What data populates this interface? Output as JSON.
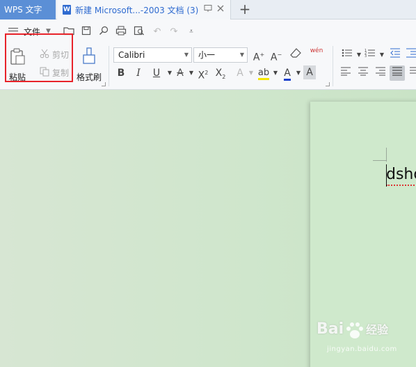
{
  "tabs": {
    "app_label": "WPS 文字",
    "doc_icon_letter": "W",
    "doc_title": "新建 Microsoft...-2003 文档 (3)",
    "new_tab": "+"
  },
  "menu": {
    "file_label": "文件"
  },
  "clipboard": {
    "paste_label": "粘贴",
    "cut_label": "剪切",
    "copy_label": "复制",
    "format_painter_label": "格式刷"
  },
  "font": {
    "family": "Calibri",
    "size": "小一",
    "phonetic_label": "wén"
  },
  "document": {
    "text": "dsho"
  },
  "watermark": {
    "brand": "Bai",
    "brand_suffix": "经验",
    "url": "jingyan.baidu.com"
  },
  "colors": {
    "accent": "#5b8fd6",
    "highlight_box": "#e8232a",
    "font_color": "#1a3fcc",
    "highlight_color": "#f5e600",
    "char_color": "#d33"
  }
}
